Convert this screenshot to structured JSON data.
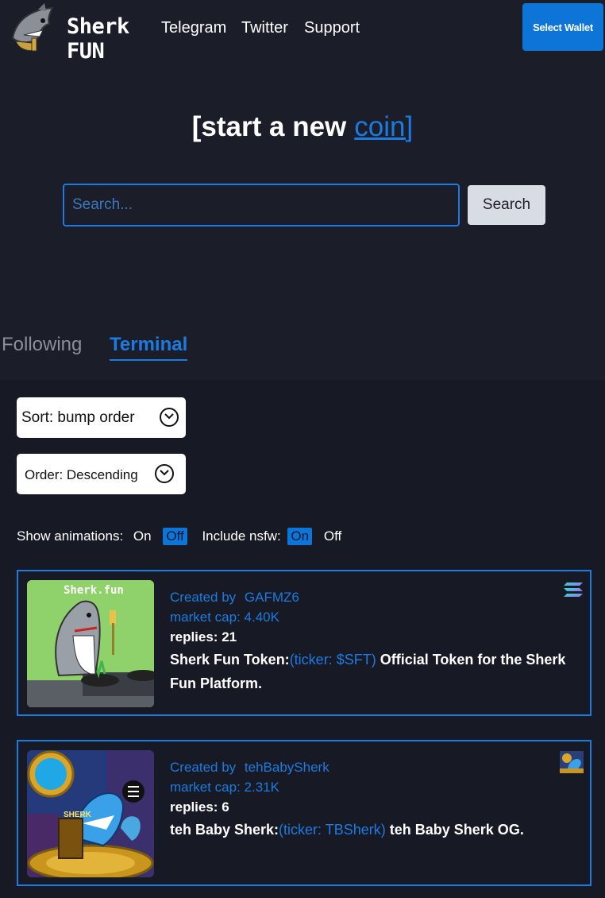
{
  "header": {
    "logo_text": "Sherk FUN",
    "nav": [
      "Telegram",
      "Twitter",
      "Support"
    ],
    "wallet_button": "Select Wallet"
  },
  "hero": {
    "prefix": "[start a new",
    "link": "coin]"
  },
  "search": {
    "placeholder": "Search...",
    "button": "Search"
  },
  "tabs": [
    {
      "label": "Following",
      "active": false
    },
    {
      "label": "Terminal",
      "active": true
    }
  ],
  "sort": {
    "label": "Sort: bump order"
  },
  "order": {
    "label": "Order: Descending"
  },
  "toggles": {
    "animations_label": "Show animations:",
    "animations_on": "On",
    "animations_off": "Off",
    "nsfw_label": "Include nsfw:",
    "nsfw_on": "On",
    "nsfw_off": "Off"
  },
  "coins": [
    {
      "created_label": "Created by",
      "creator": "GAFMZ6",
      "market_cap": "market cap: 4.40K",
      "replies": "replies: 21",
      "name": "Sherk Fun Token:",
      "ticker": "(ticker: $SFT)",
      "description": "Official Token for the Sherk Fun Platform.",
      "thumb_caption": "Sherk.fun",
      "chain_icon": "solana-icon"
    },
    {
      "created_label": "Created by",
      "creator": "tehBabySherk",
      "market_cap": "market cap: 2.31K",
      "replies": "replies: 6",
      "name": "teh Baby Sherk:",
      "ticker": "(ticker: TBSherk)",
      "description": "teh Baby Sherk OG.",
      "thumb_caption": "SHERK",
      "chain_icon": "token-thumbnail-icon"
    }
  ]
}
